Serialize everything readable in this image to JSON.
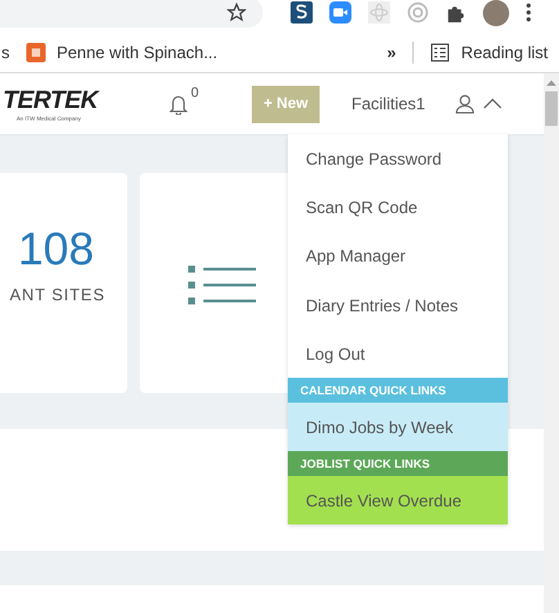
{
  "browser": {
    "bookmarks": [
      {
        "label": "s",
        "icon": false
      },
      {
        "label": "Penne with Spinach...",
        "icon": true
      }
    ],
    "overflow": "»",
    "reading_list": "Reading list"
  },
  "header": {
    "logo": "TERTEK",
    "logo_tagline": "An ITW Medical Company",
    "notifications": "0",
    "new_button": "+ New",
    "account": "Facilities1"
  },
  "cards": [
    {
      "value": "108",
      "label": "ANT SITES"
    }
  ],
  "menu": [
    {
      "kind": "item",
      "label": "Change Password"
    },
    {
      "kind": "item",
      "label": "Scan QR Code"
    },
    {
      "kind": "item",
      "label": "App Manager"
    },
    {
      "kind": "item",
      "label": "Diary Entries / Notes"
    },
    {
      "kind": "item",
      "label": "Log Out"
    },
    {
      "kind": "header",
      "label": "CALENDAR QUICK LINKS",
      "color": "#5bc0de"
    },
    {
      "kind": "link",
      "label": "Dimo Jobs by Week",
      "color": "#c8ecf7"
    },
    {
      "kind": "header",
      "label": "JOBLIST QUICK LINKS",
      "color": "#5ca858"
    },
    {
      "kind": "link",
      "label": "Castle View Overdue",
      "color": "#a3e04f"
    }
  ]
}
